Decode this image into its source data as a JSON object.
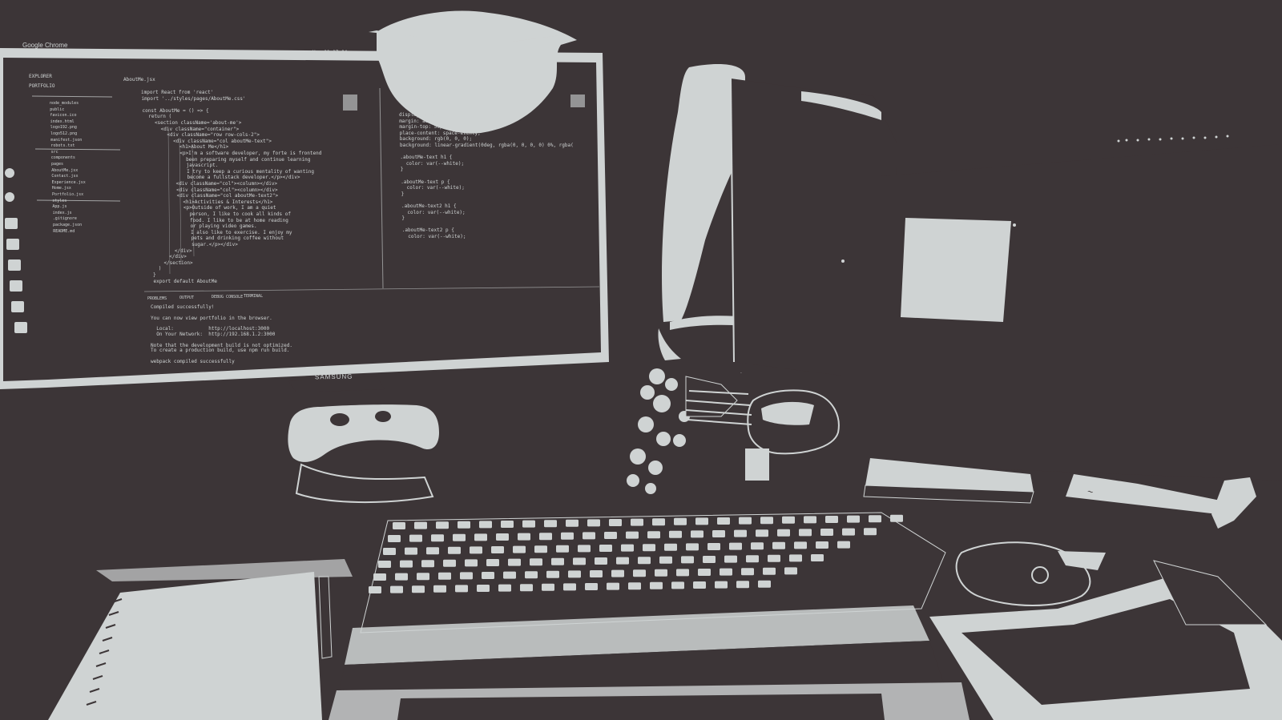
{
  "colors": {
    "background": "#3c3537",
    "light": "#cfd3d3"
  },
  "screen": {
    "window_title": "Google Chrome",
    "clock": "Ноя 11 17:04",
    "explorer_label": "EXPLORER",
    "project_name": "PORTFOLIO",
    "editor_tab": "AboutMe.jsx",
    "brand": "SAMSUNG",
    "files": [
      "node_modules",
      "public",
      "favicon.ico",
      "index.html",
      "logo192.png",
      "logo512.png",
      "manifest.json",
      "robots.txt",
      "src",
      "components",
      "pages",
      "AboutMe.jsx",
      "Contact.jsx",
      "Experience.jsx",
      "Home.jsx",
      "Portfolio.jsx",
      "styles",
      "App.js",
      "index.js",
      ".gitignore",
      "package.json",
      "README.md"
    ],
    "code_lines": [
      "import React from 'react'",
      "import '../styles/pages/AboutMe.css'",
      "",
      "const AboutMe = () => {",
      "  return (",
      "    <section className='about-me'>",
      "      <div className=\"container\">",
      "        <div className=\"row row-cols-2\">",
      "          <div className=\"col aboutMe-text\">",
      "            <h1>About Me</h1>",
      "            <p>I'm a software developer, my forte is frontend",
      "              been preparing myself and continue learning",
      "              javascript.",
      "              I try to keep a curious mentality of wanting",
      "              become a fullstack developer.</p></div>",
      "          <div className=\"col\"><column></div>",
      "          <div className=\"col\"><column></div>",
      "          <div className=\"col aboutMe-text2\">",
      "            <h1>Activities & Interests</h1>",
      "            <p>Outside of work, I am a quiet",
      "              person, I like to cook all kinds of",
      "              food. I like to be at home reading",
      "              or playing video games.",
      "              I also like to exercise. I enjoy my",
      "              pets and drinking coffee without",
      "              sugar.</p></div>",
      "        </div>",
      "      </div>",
      "    </section>",
      "  )",
      "}",
      "export default AboutMe"
    ],
    "css_lines": [
      "display: flex;",
      "margin: auto;",
      "margin-top: 50px;",
      "place-content: space-evenly;",
      "background: rgb(0, 0, 0);",
      "background: linear-gradient(0deg, rgba(0, 0, 0, 0) 0%, rgba(",
      "",
      ".aboutMe-text h1 {",
      "  color: var(--white);",
      "}",
      "",
      ".aboutMe-text p {",
      "  color: var(--white);",
      "}",
      "",
      ".aboutMe-text2 h1 {",
      "  color: var(--white);",
      "}",
      "",
      ".aboutMe-text2 p {",
      "  color: var(--white);"
    ],
    "panel_tabs": [
      "PROBLEMS",
      "OUTPUT",
      "DEBUG CONSOLE",
      "TERMINAL"
    ],
    "terminal_lines": [
      "Compiled successfully!",
      "",
      "You can now view portfolio in the browser.",
      "",
      "  Local:            http://localhost:3000",
      "  On Your Network:  http://192.168.1.2:3000",
      "",
      "Note that the development build is not optimized.",
      "To create a production build, use npm run build.",
      "",
      "webpack compiled successfully"
    ]
  }
}
